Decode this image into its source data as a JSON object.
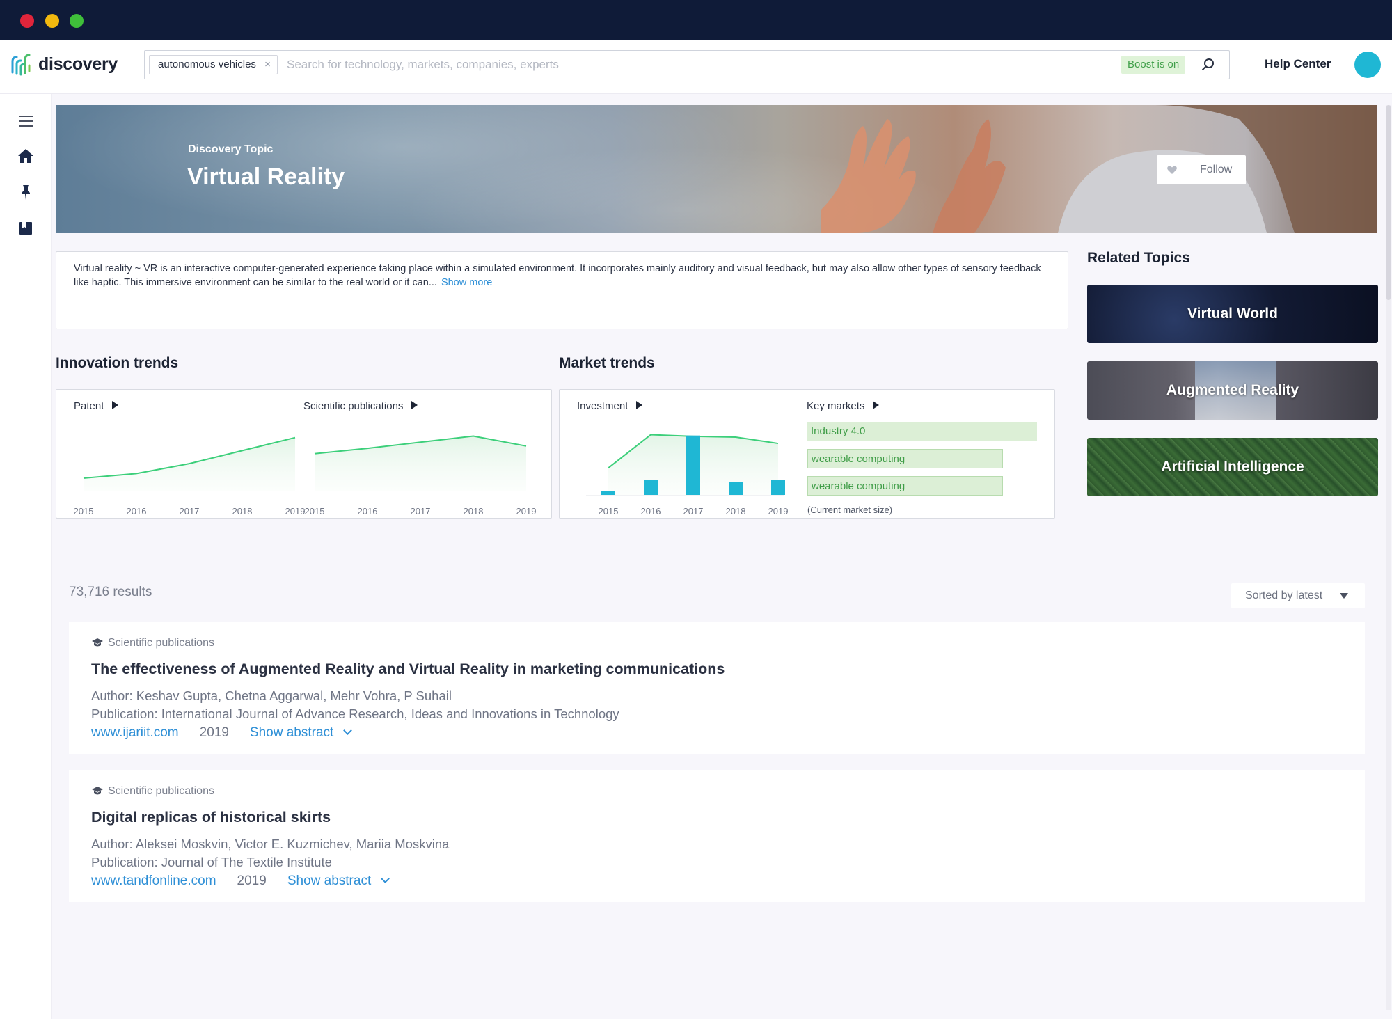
{
  "header": {
    "brand": "discovery",
    "search_chip": "autonomous vehicles",
    "search_chip_close": "×",
    "search_placeholder": "Search for technology, markets, companies, experts",
    "boost_label": "Boost is on",
    "help_label": "Help Center",
    "accent_color": "#1fb7d4"
  },
  "sidebar": {
    "items": [
      {
        "icon": "menu-icon"
      },
      {
        "icon": "home-icon"
      },
      {
        "icon": "pin-icon"
      },
      {
        "icon": "bookmark-icon"
      }
    ]
  },
  "hero": {
    "kicker": "Discovery Topic",
    "title": "Virtual Reality",
    "follow_label": "Follow"
  },
  "description": {
    "text": "Virtual reality ~ VR is an interactive computer-generated experience taking place within a simulated environment. It incorporates mainly auditory and visual feedback, but may also allow other types of sensory feedback like haptic. This immersive environment can be similar to the real world or it can...",
    "show_more": "Show more"
  },
  "innovation": {
    "heading": "Innovation trends",
    "patent": {
      "label": "Patent",
      "years": [
        "2015",
        "2016",
        "2017",
        "2018",
        "2019"
      ],
      "values": [
        1.0,
        1.6,
        2.9,
        4.6,
        6.3
      ]
    },
    "publications": {
      "label": "Scientific publications",
      "years": [
        "2015",
        "2016",
        "2017",
        "2018",
        "2019"
      ],
      "values": [
        4.2,
        4.9,
        5.7,
        6.5,
        5.2
      ]
    }
  },
  "market": {
    "heading": "Market trends",
    "investment": {
      "label": "Investment",
      "years": [
        "2015",
        "2016",
        "2017",
        "2018",
        "2019"
      ],
      "bars": [
        0.5,
        1.9,
        7.5,
        1.6,
        1.9
      ],
      "trend": [
        3.4,
        7.6,
        7.4,
        7.3,
        6.5
      ]
    },
    "key_markets": {
      "label": "Key markets",
      "items": [
        {
          "name": "Industry 4.0",
          "share": 1.0
        },
        {
          "name": "wearable computing",
          "share": 0.85
        },
        {
          "name": "wearable computing",
          "share": 0.85
        }
      ],
      "note": "(Current market size)"
    }
  },
  "related": {
    "heading": "Related Topics",
    "items": [
      "Virtual World",
      "Augmented Reality",
      "Artificial Intelligence"
    ]
  },
  "results": {
    "count": "73,716 results",
    "sort_label": "Sorted by latest",
    "items": [
      {
        "type": "Scientific publications",
        "title": "The effectiveness of Augmented Reality and Virtual Reality in marketing communications",
        "author": "Author: Keshav Gupta, Chetna Aggarwal, Mehr Vohra, P Suhail",
        "publication": "Publication: International Journal of Advance Research, Ideas and Innovations in Technology",
        "site": "www.ijariit.com",
        "year": "2019",
        "abstract_label": "Show abstract"
      },
      {
        "type": "Scientific publications",
        "title": "Digital replicas of historical skirts",
        "author": "Author: Aleksei Moskvin, Victor E. Kuzmichev, Mariia Moskvina",
        "publication": "Publication: Journal of The Textile Institute",
        "site": "www.tandfonline.com",
        "year": "2019",
        "abstract_label": "Show abstract"
      }
    ]
  }
}
